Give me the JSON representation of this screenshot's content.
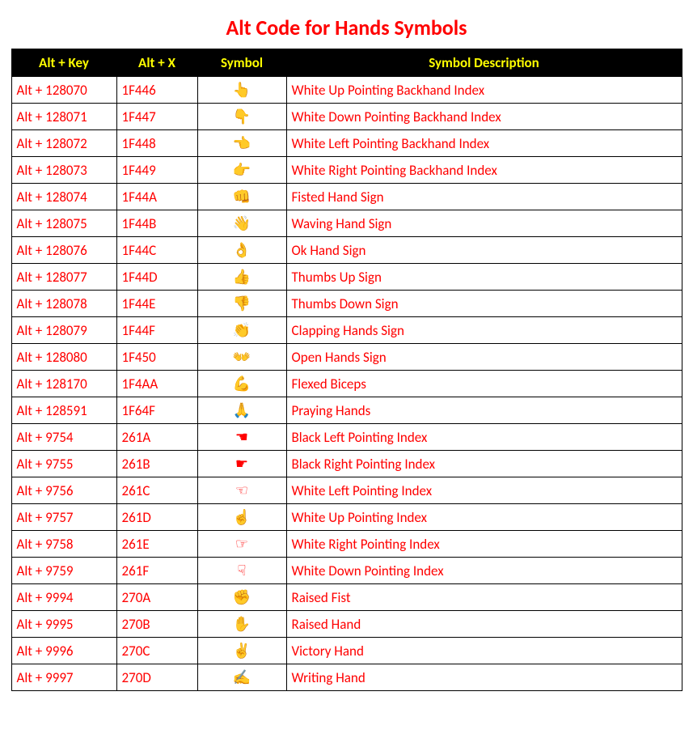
{
  "title": "Alt Code for Hands Symbols",
  "headers": {
    "altkey": "Alt + Key",
    "altx": "Alt + X",
    "symbol": "Symbol",
    "desc": "Symbol Description"
  },
  "rows": [
    {
      "altkey": "Alt + 128070",
      "altx": "1F446",
      "symbol": "👆",
      "desc": "White Up Pointing Backhand Index"
    },
    {
      "altkey": "Alt + 128071",
      "altx": "1F447",
      "symbol": "👇",
      "desc": "White Down Pointing Backhand Index"
    },
    {
      "altkey": "Alt + 128072",
      "altx": "1F448",
      "symbol": "👈",
      "desc": "White Left Pointing Backhand Index"
    },
    {
      "altkey": "Alt + 128073",
      "altx": "1F449",
      "symbol": "👉",
      "desc": "White Right Pointing Backhand Index"
    },
    {
      "altkey": "Alt + 128074",
      "altx": "1F44A",
      "symbol": "👊",
      "desc": "Fisted Hand Sign"
    },
    {
      "altkey": "Alt + 128075",
      "altx": "1F44B",
      "symbol": "👋",
      "desc": "Waving Hand Sign"
    },
    {
      "altkey": "Alt + 128076",
      "altx": "1F44C",
      "symbol": "👌",
      "desc": "Ok Hand Sign"
    },
    {
      "altkey": "Alt + 128077",
      "altx": "1F44D",
      "symbol": "👍",
      "desc": "Thumbs Up Sign"
    },
    {
      "altkey": "Alt + 128078",
      "altx": "1F44E",
      "symbol": "👎",
      "desc": "Thumbs Down Sign"
    },
    {
      "altkey": "Alt + 128079",
      "altx": "1F44F",
      "symbol": "👏",
      "desc": "Clapping Hands Sign"
    },
    {
      "altkey": "Alt + 128080",
      "altx": "1F450",
      "symbol": "👐",
      "desc": "Open Hands Sign"
    },
    {
      "altkey": "Alt + 128170",
      "altx": "1F4AA",
      "symbol": "💪",
      "desc": "Flexed Biceps"
    },
    {
      "altkey": "Alt + 128591",
      "altx": "1F64F",
      "symbol": "🙏",
      "desc": "Praying Hands"
    },
    {
      "altkey": "Alt + 9754",
      "altx": "261A",
      "symbol": "☚",
      "desc": "Black Left Pointing Index"
    },
    {
      "altkey": "Alt + 9755",
      "altx": "261B",
      "symbol": "☛",
      "desc": "Black Right Pointing Index"
    },
    {
      "altkey": "Alt + 9756",
      "altx": "261C",
      "symbol": "☜",
      "desc": "White Left Pointing Index"
    },
    {
      "altkey": "Alt + 9757",
      "altx": "261D",
      "symbol": "☝",
      "desc": "White Up Pointing Index"
    },
    {
      "altkey": "Alt + 9758",
      "altx": "261E",
      "symbol": "☞",
      "desc": "White Right Pointing Index"
    },
    {
      "altkey": "Alt + 9759",
      "altx": "261F",
      "symbol": "☟",
      "desc": "White Down Pointing Index"
    },
    {
      "altkey": "Alt + 9994",
      "altx": "270A",
      "symbol": "✊",
      "desc": "Raised Fist"
    },
    {
      "altkey": "Alt + 9995",
      "altx": "270B",
      "symbol": "✋",
      "desc": "Raised Hand"
    },
    {
      "altkey": "Alt + 9996",
      "altx": "270C",
      "symbol": "✌",
      "desc": "Victory Hand"
    },
    {
      "altkey": "Alt + 9997",
      "altx": "270D",
      "symbol": "✍",
      "desc": "Writing Hand"
    }
  ]
}
